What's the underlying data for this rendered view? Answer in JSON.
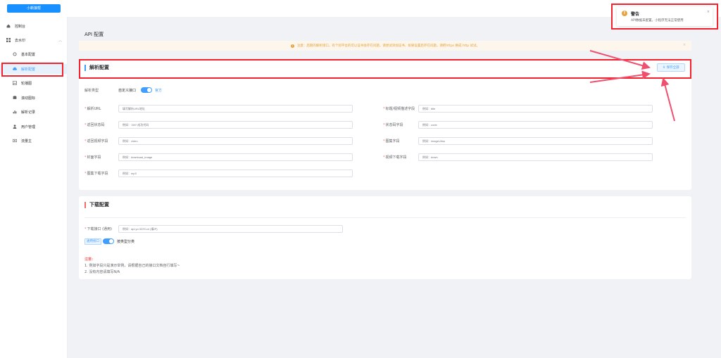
{
  "topbar": {
    "brand_label": "小新接帮"
  },
  "sidebar": {
    "items": [
      {
        "label": "控制台",
        "icon": "home-icon"
      },
      {
        "label": "去水印",
        "icon": "grid-icon"
      },
      {
        "label": "基本配置",
        "icon": "gear-icon"
      },
      {
        "label": "解析配置",
        "icon": "cloud-icon"
      },
      {
        "label": "轮播图",
        "icon": "image-icon"
      },
      {
        "label": "滚动图标",
        "icon": "stack-icon"
      },
      {
        "label": "解析记录",
        "icon": "bar-chart-icon"
      },
      {
        "label": "用户管理",
        "icon": "user-icon"
      },
      {
        "label": "流量主",
        "icon": "money-icon"
      }
    ],
    "active": "解析配置"
  },
  "main": {
    "page_title": "API 配置",
    "notice": "注意：后期的解析接口，有个别平台的可以证书会存在问题，请尝试添加证书、如果设置后存在问题，请把https 换成 http 试试。",
    "parse_card": {
      "title": "解析配置",
      "save_label": "保存全部",
      "type_label": "解析类型",
      "type_custom": "自定义接口",
      "type_official": "官方",
      "fields": [
        {
          "label": "解析URL",
          "placeholder": "填写解析URL地址"
        },
        {
          "label": "标题/视频描述字段",
          "placeholder": "例如：title"
        },
        {
          "label": "返回状态码",
          "placeholder": "例如：'200' 成功代码"
        },
        {
          "label": "状态码字段",
          "placeholder": "例如：code"
        },
        {
          "label": "返回视频字段",
          "placeholder": "例如：video"
        },
        {
          "label": "图集字段",
          "placeholder": "例如：imageUrlss"
        },
        {
          "label": "封面字段",
          "placeholder": "例如：download_image"
        },
        {
          "label": "视频下载字段",
          "placeholder": "例如：down"
        },
        {
          "label": "图集下载字段",
          "placeholder": "例如：mp3"
        }
      ]
    },
    "download_card": {
      "title": "下载配置",
      "field_label": "下载接口 (通用)",
      "field_placeholder": "例如：api.yo.3229.cn (填IP)",
      "tag_label": "通用接口",
      "switch_label": "按类型分类",
      "note_title": "注意:",
      "notes": [
        "1. 例如字段只是演示举例，请根据自己的接口文档自行填写~",
        "2. 没有内容请填写N/A"
      ]
    }
  },
  "toast": {
    "title": "警告",
    "message": "API数据未配置，小程序无法正常使用"
  },
  "colors": {
    "primary": "#409eff",
    "warning": "#e6a23c",
    "danger": "#f56c6c",
    "annotation": "#f5222d"
  }
}
